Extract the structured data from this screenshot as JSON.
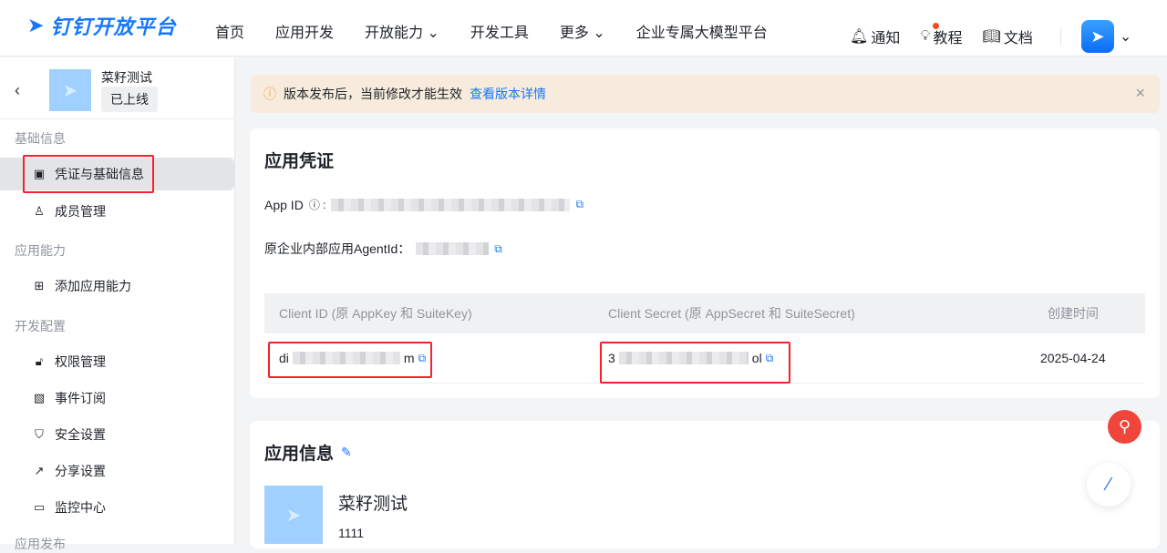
{
  "header": {
    "brand": "钉钉开放平台",
    "nav": [
      "首页",
      "应用开发",
      "开放能力",
      "开发工具",
      "更多",
      "企业专属大模型平台"
    ],
    "right": {
      "notify": "通知",
      "tutorial": "教程",
      "docs": "文档"
    }
  },
  "sidebar": {
    "app_name": "菜籽测试",
    "status": "已上线",
    "groups": [
      {
        "title": "基础信息",
        "items": [
          {
            "label": "凭证与基础信息",
            "icon": "credential-icon"
          },
          {
            "label": "成员管理",
            "icon": "member-icon"
          }
        ]
      },
      {
        "title": "应用能力",
        "items": [
          {
            "label": "添加应用能力",
            "icon": "add-app-icon"
          }
        ]
      },
      {
        "title": "开发配置",
        "items": [
          {
            "label": "权限管理",
            "icon": "lock-icon"
          },
          {
            "label": "事件订阅",
            "icon": "rss-icon"
          },
          {
            "label": "安全设置",
            "icon": "shield-icon"
          },
          {
            "label": "分享设置",
            "icon": "share-icon"
          },
          {
            "label": "监控中心",
            "icon": "monitor-icon"
          }
        ]
      },
      {
        "title": "应用发布",
        "items": []
      }
    ]
  },
  "notice": {
    "text": "版本发布后，当前修改才能生效",
    "link": "查看版本详情"
  },
  "credentials": {
    "title": "应用凭证",
    "app_id_label": "App ID",
    "agent_label": "原企业内部应用AgentId：",
    "table": {
      "headers": [
        "Client ID (原 AppKey 和 SuiteKey)",
        "Client Secret (原 AppSecret 和 SuiteSecret)",
        "创建时间"
      ],
      "row": {
        "client_id_prefix": "di",
        "client_id_suffix": "m",
        "secret_prefix": "3",
        "secret_suffix": "ol",
        "created": "2025-04-24"
      }
    }
  },
  "app_info": {
    "title": "应用信息",
    "name": "菜籽测试",
    "desc": "1111"
  },
  "colors": {
    "accent": "#1677ff",
    "highlight": "#f5222d",
    "notice_bg": "#f6ebdc"
  }
}
